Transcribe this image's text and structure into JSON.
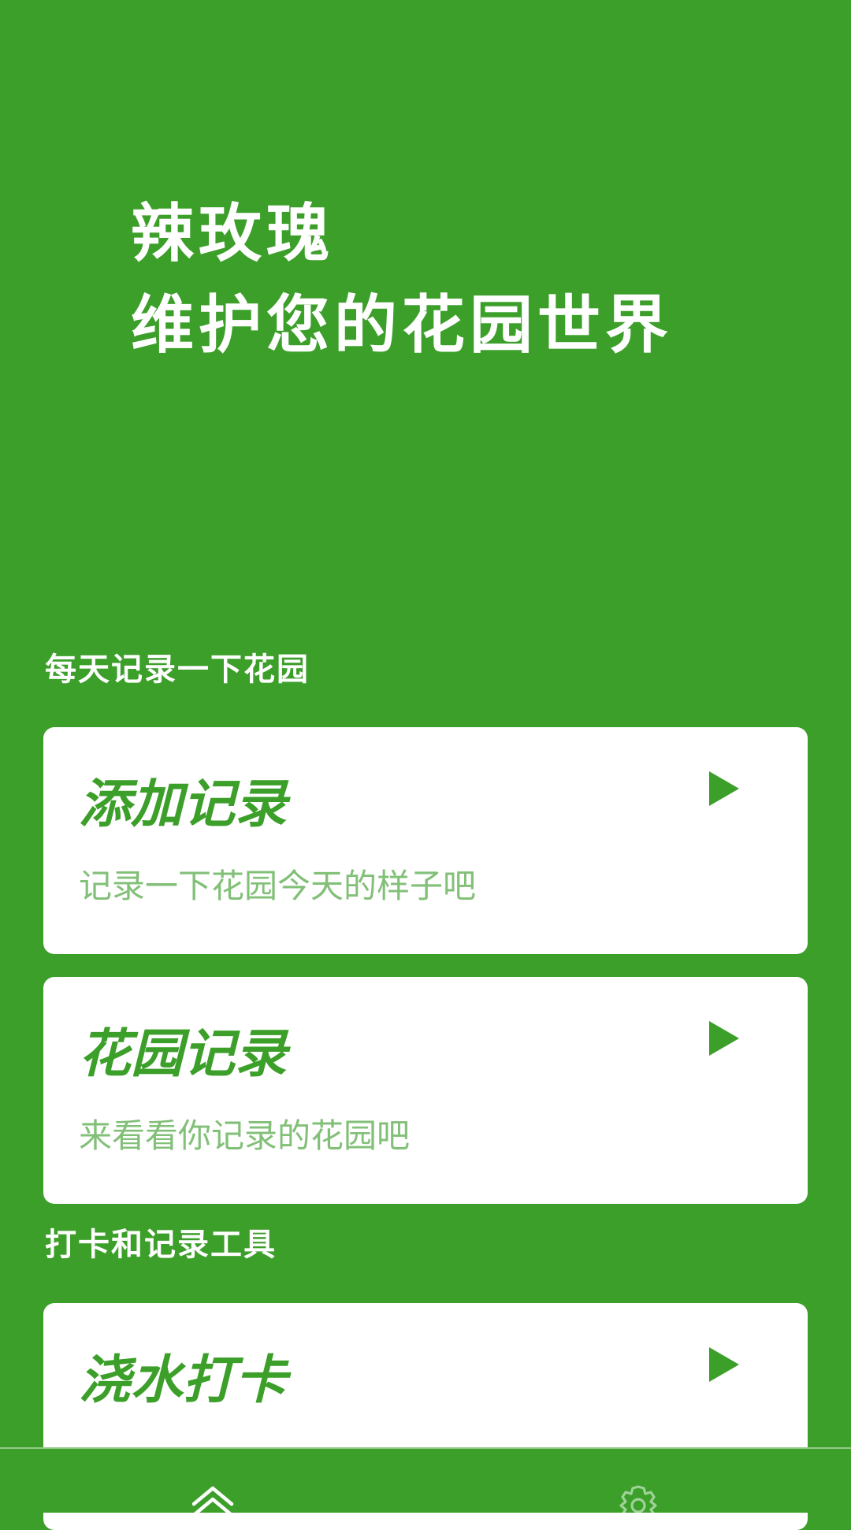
{
  "hero": {
    "line1": "辣玫瑰",
    "line2": "维护您的花园世界"
  },
  "sections": {
    "daily_title": "每天记录一下花园",
    "tools_title": "打卡和记录工具"
  },
  "cards": [
    {
      "title": "添加记录",
      "subtitle": "记录一下花园今天的样子吧"
    },
    {
      "title": "花园记录",
      "subtitle": "来看看你记录的花园吧"
    },
    {
      "title": "浇水打卡",
      "subtitle": ""
    }
  ],
  "icons": {
    "card_action": "play-icon",
    "nav_home": "chevron-up-icon",
    "nav_settings": "gear-icon"
  },
  "colors": {
    "background": "#3c9f2a",
    "card": "#ffffff",
    "card_title": "#3c9f2a",
    "card_subtitle": "#82c078",
    "nav_icon": "#ffffff",
    "nav_icon_inactive": "#9fd296"
  }
}
